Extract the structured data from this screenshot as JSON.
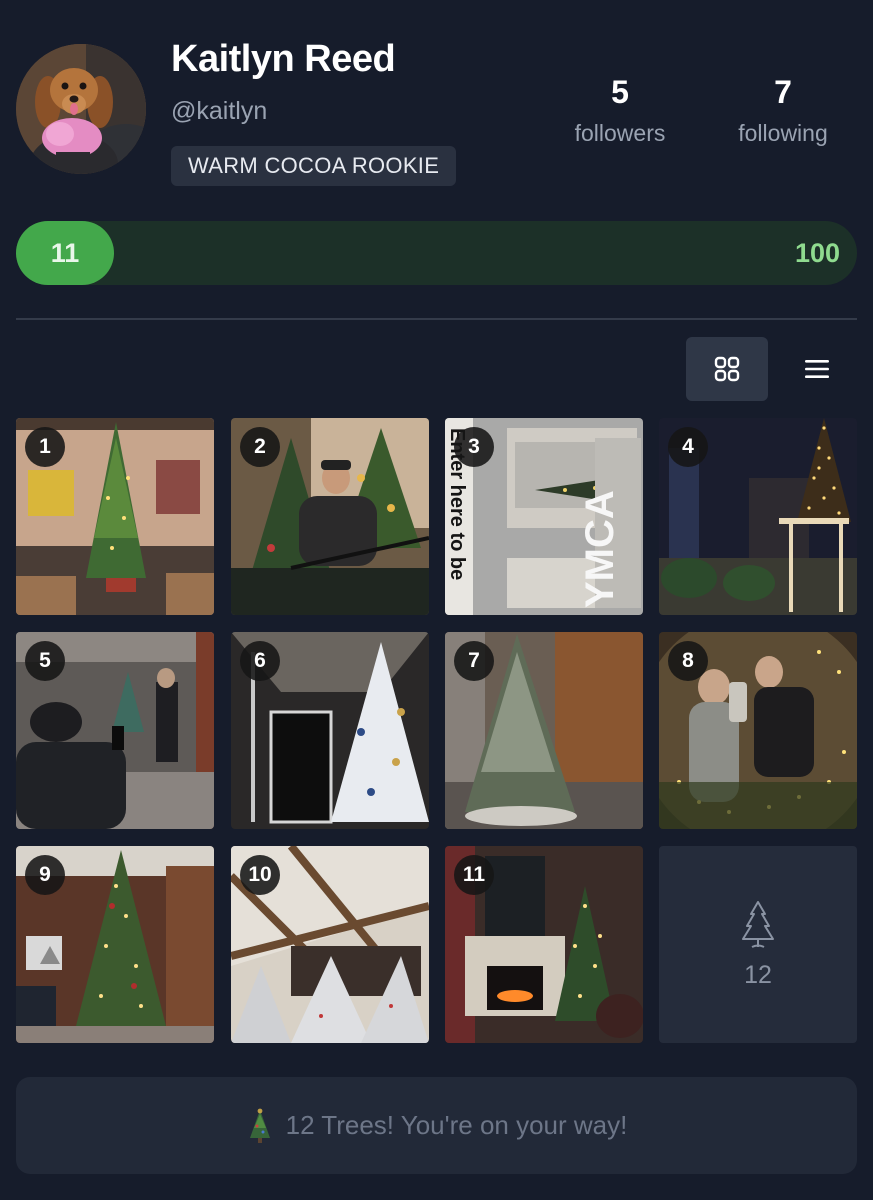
{
  "profile": {
    "name": "Kaitlyn Reed",
    "handle": "@kaitlyn",
    "rank": "WARM COCOA ROOKIE",
    "avatar_icon": "dog-avatar"
  },
  "stats": {
    "followers": {
      "value": "5",
      "label": "followers"
    },
    "following": {
      "value": "7",
      "label": "following"
    }
  },
  "progress": {
    "current": "11",
    "goal": "100",
    "fraction": 0.11,
    "fill_color": "#43a84b",
    "track_color": "#1c3028"
  },
  "view_toggle": {
    "grid_icon": "grid-icon",
    "list_icon": "menu-icon",
    "selected": "grid"
  },
  "trees": [
    {
      "number": "1",
      "scene": "hotel lobby tree"
    },
    {
      "number": "2",
      "scene": "man with tree"
    },
    {
      "number": "3",
      "scene": "ymca window tree"
    },
    {
      "number": "4",
      "scene": "night street tree"
    },
    {
      "number": "5",
      "scene": "man photographing tree"
    },
    {
      "number": "6",
      "scene": "white tree hallway"
    },
    {
      "number": "7",
      "scene": "frosted tree"
    },
    {
      "number": "8",
      "scene": "ornament selfie"
    },
    {
      "number": "9",
      "scene": "tall lit tree"
    },
    {
      "number": "10",
      "scene": "flocked trees"
    },
    {
      "number": "11",
      "scene": "fireplace tree"
    }
  ],
  "next_slot": {
    "number": "12",
    "icon": "tree-outline-icon"
  },
  "banner": {
    "icon": "christmas-tree-icon",
    "text": "12 Trees! You're on your way!"
  }
}
